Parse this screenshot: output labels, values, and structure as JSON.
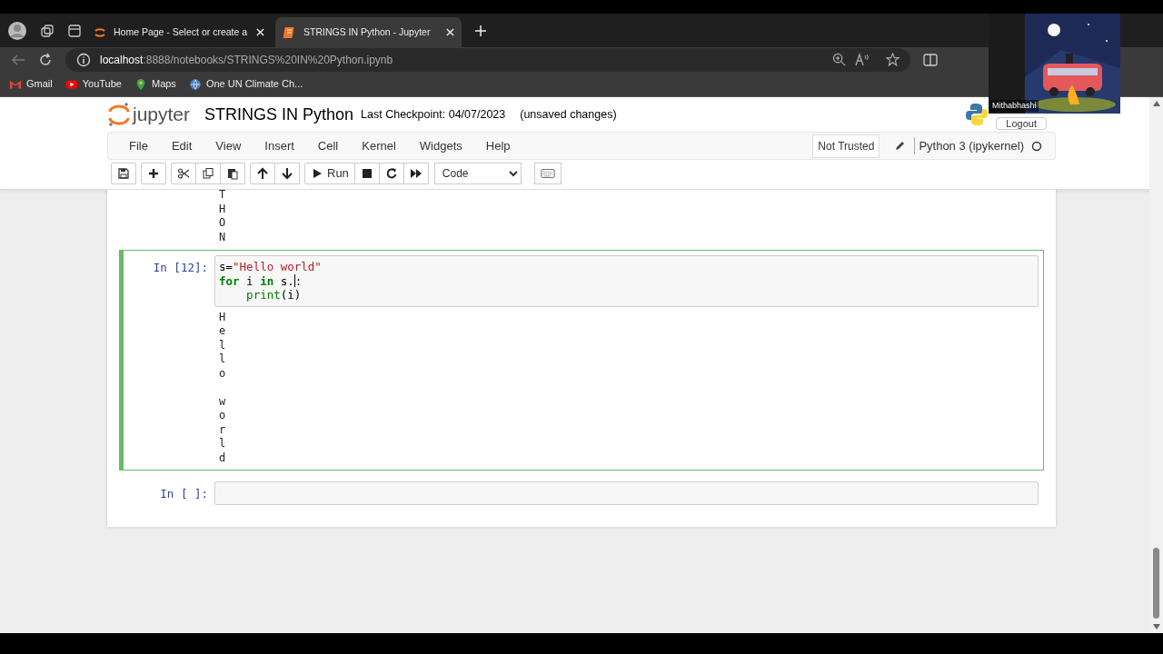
{
  "browser": {
    "tabs": [
      {
        "title": "Home Page - Select or create a",
        "kind": "jupyter",
        "selected": false
      },
      {
        "title": "STRINGS IN Python - Jupyter",
        "kind": "notebook",
        "selected": true
      }
    ],
    "address": {
      "host": "localhost",
      "path": ":8888/notebooks/STRINGS%20IN%20Python.ipynb"
    },
    "bookmarks": [
      {
        "label": "Gmail",
        "kind": "mail"
      },
      {
        "label": "YouTube",
        "kind": "video"
      },
      {
        "label": "Maps",
        "kind": "pin"
      },
      {
        "label": "One UN Climate Ch...",
        "kind": "globe"
      }
    ]
  },
  "webcam": {
    "name": "Mithabhashi",
    "kind": "picture"
  },
  "notebook": {
    "title": "STRINGS IN Python",
    "checkpoint": "Last Checkpoint: 04/07/2023",
    "autosave": "(unsaved changes)",
    "logout": "Logout",
    "menu": [
      "File",
      "Edit",
      "View",
      "Insert",
      "Cell",
      "Kernel",
      "Widgets",
      "Help"
    ],
    "trust": "Not Trusted",
    "kernel": "Python 3 (ipykernel)",
    "kernel_busy": false,
    "toolbar": [
      [
        {
          "kind": "save"
        }
      ],
      [
        {
          "kind": "add"
        }
      ],
      [
        {
          "kind": "cut"
        },
        {
          "kind": "copy"
        },
        {
          "kind": "paste"
        }
      ],
      [
        {
          "kind": "up"
        },
        {
          "kind": "down"
        }
      ],
      [
        {
          "kind": "run"
        },
        {
          "kind": "stop"
        },
        {
          "kind": "restart"
        },
        {
          "kind": "fastforward"
        }
      ]
    ],
    "run_label": "Run",
    "cell_type": "Code"
  },
  "cells": [
    {
      "selected": false,
      "output": [
        [
          "T",
          "H",
          "O",
          "N"
        ]
      ]
    },
    {
      "selected": true,
      "prompt": "In [12]:",
      "code": [
        [
          {
            "text": "s=",
            "kind": "plain"
          },
          {
            "text": "\"Hello world\"",
            "kind": "string"
          }
        ],
        [
          {
            "text": "for",
            "kind": "keyword"
          },
          {
            "text": " i ",
            "kind": "plain"
          },
          {
            "text": "in",
            "kind": "keyword"
          },
          {
            "text": " s.",
            "kind": "plain",
            "caret": true
          },
          {
            "text": ":",
            "kind": "plain"
          }
        ],
        [
          {
            "text": "    print",
            "kind": "builtin"
          },
          {
            "text": "(i)",
            "kind": "plain"
          }
        ]
      ],
      "output": [
        [
          "H",
          "e",
          "l",
          "l",
          "o"
        ],
        [
          "w",
          "o",
          "r",
          "l",
          "d"
        ]
      ]
    },
    {
      "selected": false,
      "prompt": "In [ ]:"
    }
  ]
}
